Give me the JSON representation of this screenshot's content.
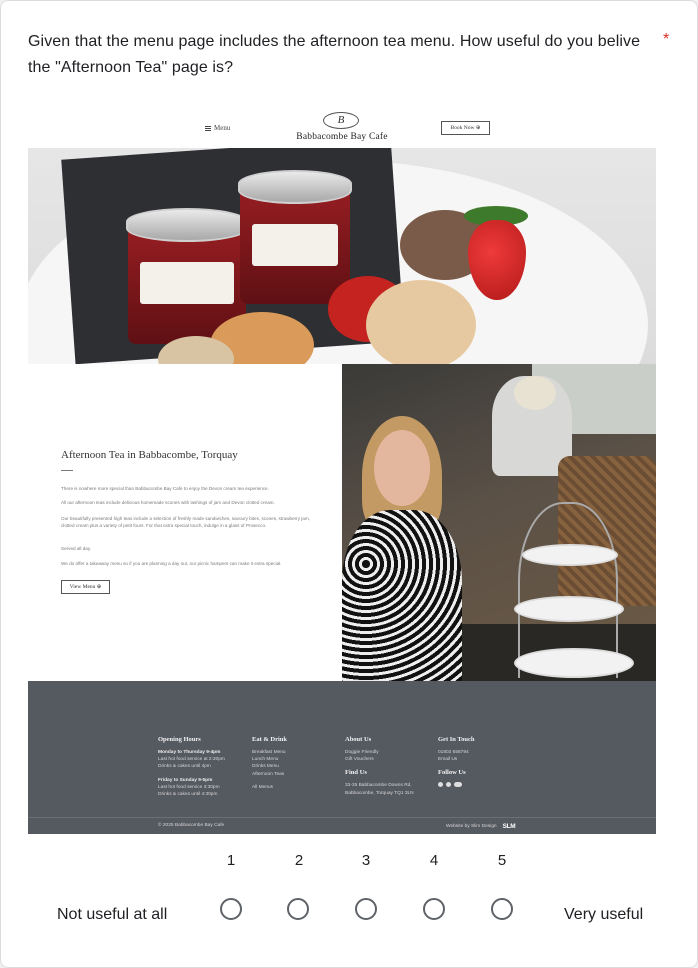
{
  "question": {
    "text": "Given that the menu page includes the afternoon tea menu. How useful do you belive the \"Afternoon Tea\" page is?",
    "required_marker": "*"
  },
  "site": {
    "menu_label": "Menu",
    "logo_mark": "B",
    "logo_text": "Babbacombe Bay Cafe",
    "book_button": "Book Now ⊕",
    "intro": {
      "title": "Afternoon Tea in Babbacombe, Torquay",
      "paragraphs": [
        "There is nowhere more special than Babbacombe Bay Cafe to enjoy the Devon cream tea experience.",
        "All our afternoon teas include delicious homemade scones with lashings of jam and Devon clotted cream.",
        "Our beautifully presented high teas include a selection of freshly made sandwiches, savoury bites, scones, strawberry jam, clotted cream plus a variety of petit fours. For that extra special touch, indulge in a glass of Prosecco.",
        "Served all day.",
        "We do offer a takeaway menu so if you are planning a day out, our picnic hampers can make it extra special."
      ],
      "view_button": "View Menu ⊕"
    },
    "footer": {
      "opening": {
        "title": "Opening Hours",
        "weekday_head": "Monday to Thursday 9-4pm",
        "weekday_lines": [
          "Last hot food service at 2:30pm",
          "Drinks & cakes until 4pm"
        ],
        "weekend_head": "Friday to Sunday 9-5pm",
        "weekend_lines": [
          "Last hot food service 3:30pm",
          "Drinks & cakes until 4:30pm"
        ]
      },
      "eat_drink": {
        "title": "Eat & Drink",
        "items": [
          "Breakfast Menu",
          "Lunch Menu",
          "Drinks Menu",
          "Afternoon Teas"
        ],
        "all_menus": "All Menus"
      },
      "about": {
        "title": "About Us",
        "items": [
          "Doggie Friendly",
          "Gift Vouchers"
        ],
        "find_title": "Find Us",
        "address": [
          "33-35 Babbacombe Downs Rd,",
          "Babbacombe, Torquay TQ1 3LN"
        ]
      },
      "contact": {
        "title": "Get In Touch",
        "phone": "01803 658794",
        "email": "Email Us",
        "follow_title": "Follow Us",
        "social_icons": [
          "facebook-icon",
          "instagram-icon",
          "tripadvisor-icon"
        ]
      },
      "copyright": "© 2025 Babbacombe Bay Cafe",
      "credit": "Website by Slim Design",
      "credit_logo": "SLM"
    }
  },
  "scale": {
    "options": [
      "1",
      "2",
      "3",
      "4",
      "5"
    ],
    "low_label": "Not useful at all",
    "high_label": "Very useful",
    "selected": null
  }
}
